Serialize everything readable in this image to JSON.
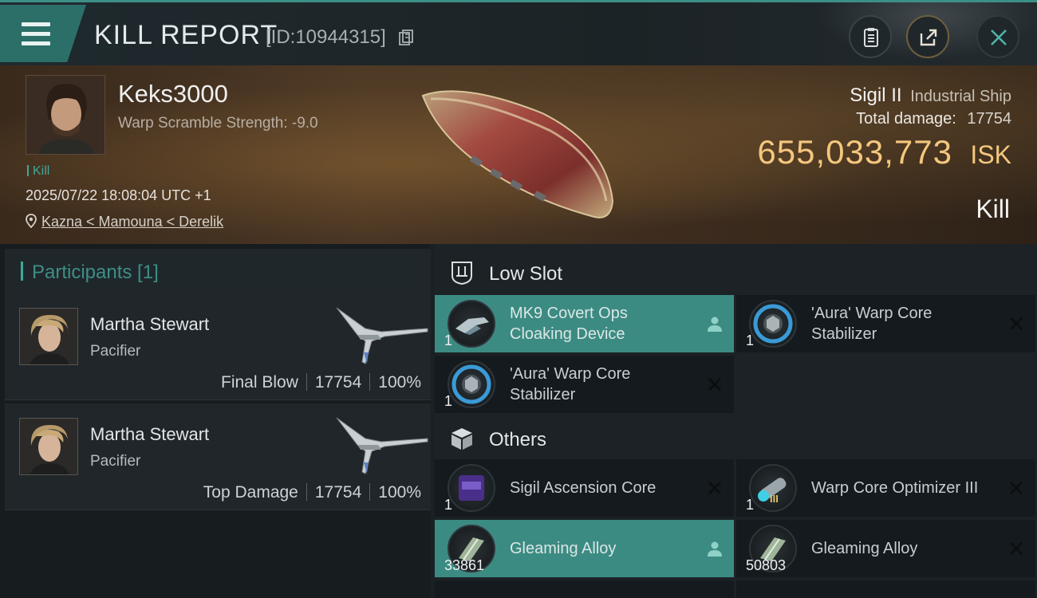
{
  "header": {
    "title": "KILL REPORT",
    "report_id": "[ID:10944315]"
  },
  "victim": {
    "pilot_name": "Keks3000",
    "warp_scramble": "Warp Scramble Strength: -9.0",
    "tag": "Kill",
    "datetime": "2025/07/22 18:08:04 UTC +1",
    "location": "Kazna < Mamouna < Derelik",
    "ship_name": "Sigil II",
    "ship_class": "Industrial Ship",
    "total_damage_label": "Total damage:",
    "total_damage_value": "17754",
    "isk_value": "655,033,773",
    "isk_unit": "ISK",
    "result": "Kill"
  },
  "participants": {
    "label": "Participants [1]",
    "cards": [
      {
        "name": "Martha Stewart",
        "ship": "Pacifier",
        "role": "Final Blow",
        "damage": "17754",
        "percent": "100%"
      },
      {
        "name": "Martha Stewart",
        "ship": "Pacifier",
        "role": "Top Damage",
        "damage": "17754",
        "percent": "100%"
      }
    ]
  },
  "low_slot": {
    "label": "Low Slot",
    "items": [
      {
        "qty": "1",
        "name": "MK9 Covert Ops Cloaking Device",
        "state": "person"
      },
      {
        "qty": "1",
        "name": "'Aura' Warp Core Stabilizer",
        "state": "destroyed"
      },
      {
        "qty": "1",
        "name": "'Aura' Warp Core Stabilizer",
        "state": "destroyed"
      }
    ]
  },
  "others": {
    "label": "Others",
    "items": [
      {
        "qty": "1",
        "name": "Sigil Ascension Core",
        "state": "destroyed"
      },
      {
        "qty": "1",
        "name": "Warp Core Optimizer III",
        "state": "destroyed",
        "tier_badge": "III"
      },
      {
        "qty": "33861",
        "name": "Gleaming Alloy",
        "state": "person"
      },
      {
        "qty": "50803",
        "name": "Gleaming Alloy",
        "state": "destroyed"
      }
    ]
  },
  "colors": {
    "accent": "#3c8b83",
    "isk": "#f4c77e",
    "highlight_row": "#3c8b83"
  }
}
